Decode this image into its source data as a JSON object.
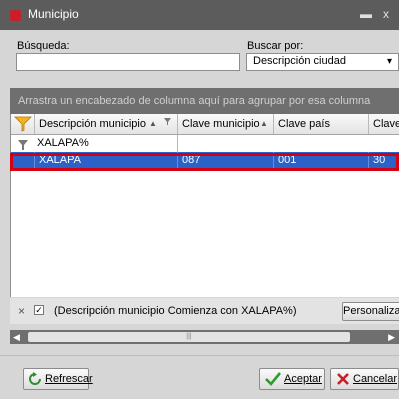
{
  "window": {
    "title": "Municipio",
    "minimize_glyph": "▬",
    "close_glyph": "x"
  },
  "search": {
    "label": "Búsqueda:",
    "value": ""
  },
  "search_by": {
    "label": "Buscar por:",
    "value": "Descripción ciudad",
    "arrow": "▾"
  },
  "group_hint": "Arrastra un encabezado de columna aquí para agrupar por esa columna",
  "grid": {
    "columns": [
      {
        "label": "Descripción municipio",
        "sort": "▲"
      },
      {
        "label": "Clave municipio",
        "sort": "▲"
      },
      {
        "label": "Clave país",
        "sort": ""
      },
      {
        "label": "Clave es",
        "sort": ""
      }
    ],
    "filter_row": {
      "value": "XALAPA%"
    },
    "rows": [
      {
        "descripcion": "XALAPA",
        "clave_municipio": "087",
        "clave_pais": "001",
        "clave_estado": "30"
      }
    ]
  },
  "filter_status": {
    "close_glyph": "×",
    "checked": true,
    "text": "(Descripción municipio Comienza con XALAPA%)",
    "customize_label": "Personalizar..."
  },
  "hscroll": {
    "left_arrow": "◀",
    "right_arrow": "▶",
    "grip": "|||"
  },
  "buttons": {
    "refresh": "Refrescar",
    "accept": "Aceptar",
    "cancel": "Cancelar"
  },
  "colors": {
    "selection": "#2a62c8",
    "highlight_border": "#d40012",
    "title_bar": "#5c5c5c"
  }
}
